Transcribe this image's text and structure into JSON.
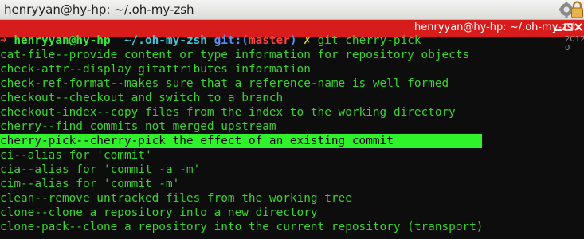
{
  "window": {
    "title": "henryyan@hy-hp: ~/.oh-my-zsh"
  },
  "terminal_bar": {
    "title": "henryyan@hy-hp: ~/.oh-my-zsh"
  },
  "peek": {
    "text": "2012-0"
  },
  "prompt": {
    "arrow": "➜",
    "user": "henryyan@hy-hp",
    "dir": "~/.oh-my-zsh",
    "git_prefix": "git:(",
    "branch": "master",
    "git_suffix": ")",
    "dirty_marker": "✗",
    "command": "git cherry-pick"
  },
  "completions": [
    {
      "name": "cat-file",
      "sep": "--",
      "desc": "provide content or type information for repository objects"
    },
    {
      "name": "check-attr",
      "sep": "--",
      "desc": "display gitattributes information"
    },
    {
      "name": "check-ref-format",
      "sep": "--",
      "desc": "makes sure that a reference-name is well formed"
    },
    {
      "name": "checkout",
      "sep": "--",
      "desc": "checkout and switch to a branch"
    },
    {
      "name": "checkout-index",
      "sep": "--",
      "desc": "copy files from the index to the working directory"
    },
    {
      "name": "cherry",
      "sep": "--",
      "desc": "find commits not merged upstream"
    },
    {
      "name": "cherry-pick",
      "sep": "--",
      "desc": "cherry-pick the effect of an existing commit",
      "selected": true
    },
    {
      "name": "ci",
      "sep": "--",
      "desc": "alias for 'commit'"
    },
    {
      "name": "cia",
      "sep": "--",
      "desc": "alias for 'commit -a -m'"
    },
    {
      "name": "cim",
      "sep": "--",
      "desc": "alias for 'commit -m'"
    },
    {
      "name": "clean",
      "sep": "--",
      "desc": "remove untracked files from the working tree"
    },
    {
      "name": "clone",
      "sep": "--",
      "desc": "clone a repository into a new directory"
    },
    {
      "name": "clone-pack",
      "sep": "--",
      "desc": "clone a repository into the current repository (transport)"
    }
  ],
  "icons": {
    "gear": "gear-icon",
    "lock": "lock-icon",
    "minimize": "minimize-icon",
    "maximize": "maximize-icon",
    "close": "close-icon"
  },
  "colors": {
    "terminal_bar": "#d81c1c",
    "selection": "#2ff22a",
    "text": "#39d430"
  }
}
